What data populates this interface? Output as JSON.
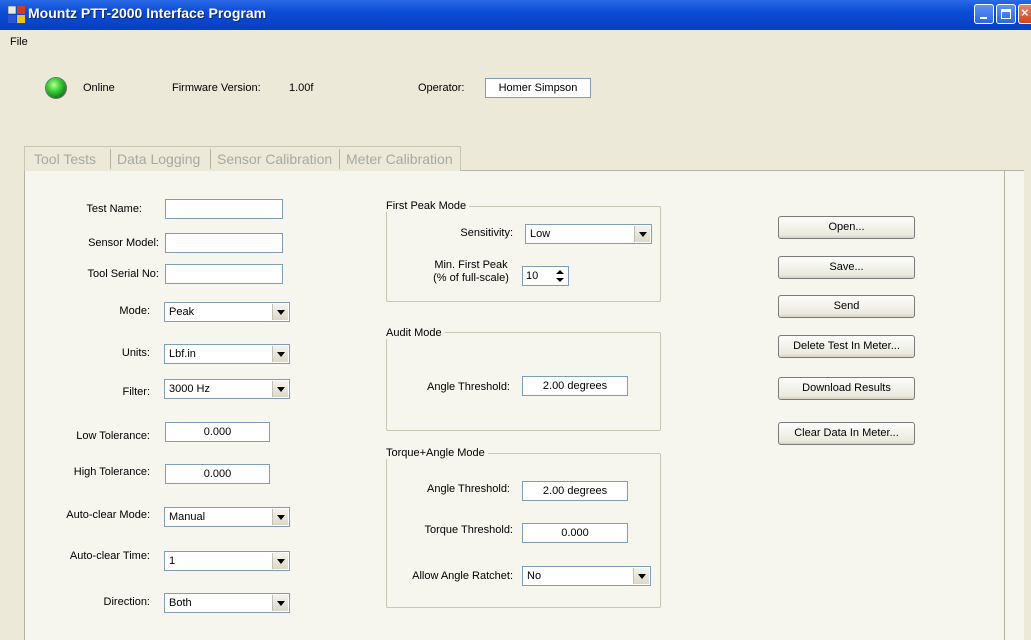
{
  "window": {
    "title": "Mountz PTT-2000 Interface Program"
  },
  "menu": {
    "file": "File"
  },
  "status": {
    "online_label": "Online",
    "firmware_label": "Firmware Version:",
    "firmware_value": "1.00f",
    "operator_label": "Operator:",
    "operator_value": "Homer Simpson"
  },
  "tabs": [
    "Tool Tests",
    "Data Logging",
    "Sensor Calibration",
    "Meter Calibration"
  ],
  "tool_tests": {
    "test_name_label": "Test Name:",
    "test_name_value": "",
    "sensor_model_label": "Sensor Model:",
    "sensor_model_value": "",
    "tool_serial_label": "Tool Serial No:",
    "tool_serial_value": "",
    "mode_label": "Mode:",
    "mode_value": "Peak",
    "units_label": "Units:",
    "units_value": "Lbf.in",
    "filter_label": "Filter:",
    "filter_value": "3000 Hz",
    "low_tol_label": "Low Tolerance:",
    "low_tol_value": "0.000",
    "high_tol_label": "High Tolerance:",
    "high_tol_value": "0.000",
    "autoclear_mode_label": "Auto-clear Mode:",
    "autoclear_mode_value": "Manual",
    "autoclear_time_label": "Auto-clear Time:",
    "autoclear_time_value": "1",
    "direction_label": "Direction:",
    "direction_value": "Both"
  },
  "first_peak": {
    "title": "First Peak Mode",
    "sensitivity_label": "Sensitivity:",
    "sensitivity_value": "Low",
    "min_first_peak_label1": "Min. First Peak",
    "min_first_peak_label2": "(% of full-scale)",
    "min_first_peak_value": "10"
  },
  "audit": {
    "title": "Audit Mode",
    "angle_threshold_label": "Angle Threshold:",
    "angle_threshold_value": "2.00 degrees"
  },
  "torque_angle": {
    "title": "Torque+Angle Mode",
    "angle_threshold_label": "Angle Threshold:",
    "angle_threshold_value": "2.00 degrees",
    "torque_threshold_label": "Torque Threshold:",
    "torque_threshold_value": "0.000",
    "ratchet_label": "Allow Angle Ratchet:",
    "ratchet_value": "No"
  },
  "buttons": {
    "open": "Open...",
    "save": "Save...",
    "send": "Send",
    "delete": "Delete Test In Meter...",
    "download": "Download Results",
    "clear": "Clear Data In Meter..."
  },
  "colors": {
    "title_bar": "#0a4bd6",
    "led": "#3fd13b",
    "background": "#ece9d8"
  }
}
